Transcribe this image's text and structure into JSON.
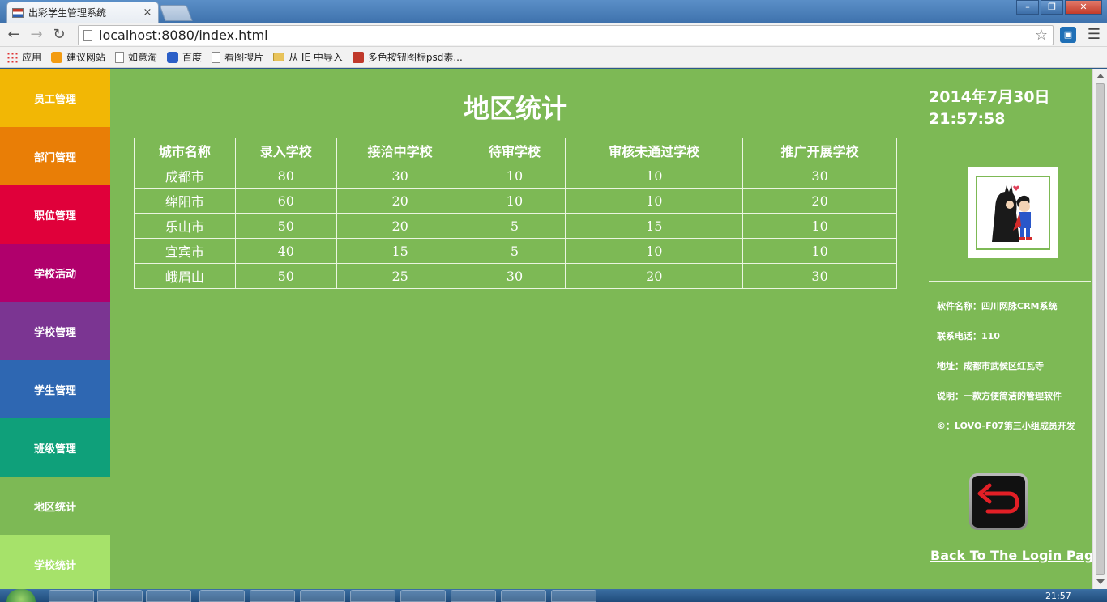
{
  "browser": {
    "tab_title": "出彩学生管理系统",
    "tab_close": "×",
    "url": "localhost:8080/index.html",
    "bookmarks": [
      "应用",
      "建议网站",
      "如意淘",
      "百度",
      "看图搜片",
      "从 IE 中导入",
      "多色按钮图标psd素..."
    ]
  },
  "sidebar": {
    "items": [
      {
        "label": "员工管理",
        "color": "#f2b705"
      },
      {
        "label": "部门管理",
        "color": "#e97e06"
      },
      {
        "label": "职位管理",
        "color": "#e0003a"
      },
      {
        "label": "学校活动",
        "color": "#b0006c"
      },
      {
        "label": "学校管理",
        "color": "#7b3592"
      },
      {
        "label": "学生管理",
        "color": "#2e67b2"
      },
      {
        "label": "班级管理",
        "color": "#0fa07a"
      },
      {
        "label": "地区统计",
        "color": "#7db955"
      },
      {
        "label": "学校统计",
        "color": "#a6e26a"
      }
    ]
  },
  "main": {
    "title": "地区统计",
    "table": {
      "headers": [
        "城市名称",
        "录入学校",
        "接洽中学校",
        "待审学校",
        "审核未通过学校",
        "推广开展学校"
      ],
      "rows": [
        [
          "成都市",
          "80",
          "30",
          "10",
          "10",
          "30"
        ],
        [
          "绵阳市",
          "60",
          "20",
          "10",
          "10",
          "20"
        ],
        [
          "乐山市",
          "50",
          "20",
          "5",
          "15",
          "10"
        ],
        [
          "宜宾市",
          "40",
          "15",
          "5",
          "10",
          "10"
        ],
        [
          "峨眉山",
          "50",
          "25",
          "30",
          "20",
          "30"
        ]
      ]
    }
  },
  "right_panel": {
    "date": "2014年7月30日",
    "time": "21:57:58",
    "info": [
      "软件名称：四川网脉CRM系统",
      "联系电话：110",
      "地址：成都市武侯区红瓦寺",
      "说明：一款方便简洁的管理软件",
      "©：LOVO-F07第三小组成员开发"
    ],
    "back_link": "Back To The Login Page"
  },
  "taskbar": {
    "clock": "21:57"
  },
  "colors": {
    "page_bg": "#7db955",
    "text": "#ffffff"
  }
}
